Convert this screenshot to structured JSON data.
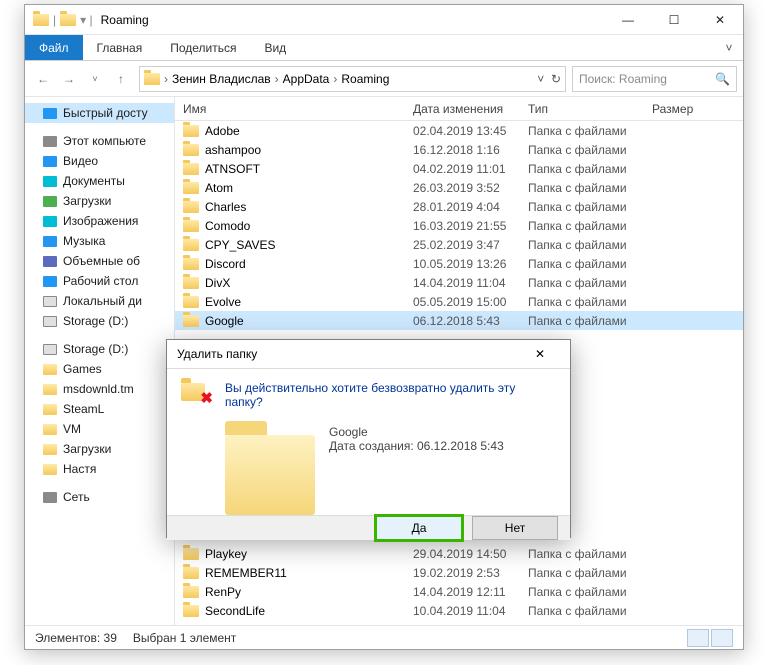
{
  "window": {
    "title": "Roaming"
  },
  "ribbon": {
    "file": "Файл",
    "home": "Главная",
    "share": "Поделиться",
    "view": "Вид"
  },
  "breadcrumb": {
    "parts": [
      "Зенин Владислав",
      "AppData",
      "Roaming"
    ]
  },
  "search": {
    "placeholder": "Поиск: Roaming"
  },
  "columns": {
    "name": "Имя",
    "date": "Дата изменения",
    "type": "Тип",
    "size": "Размер"
  },
  "nav": {
    "quick": "Быстрый досту",
    "thispc": "Этот компьюте",
    "video": "Видео",
    "docs": "Документы",
    "downloads": "Загрузки",
    "images": "Изображения",
    "music": "Музыка",
    "volume": "Объемные об",
    "desktop": "Рабочий стол",
    "localdisk": "Локальный ди",
    "storage1": "Storage (D:)",
    "storage2": "Storage (D:)",
    "games": "Games",
    "msdownld": "msdownld.tm",
    "steaml": "SteamL",
    "vm": "VM",
    "downloads2": "Загрузки",
    "nastya": "Настя",
    "network": "Сеть"
  },
  "type_folder": "Папка с файлами",
  "rows": [
    {
      "name": "Adobe",
      "date": "02.04.2019 13:45"
    },
    {
      "name": "ashampoo",
      "date": "16.12.2018 1:16"
    },
    {
      "name": "ATNSOFT",
      "date": "04.02.2019 11:01"
    },
    {
      "name": "Atom",
      "date": "26.03.2019 3:52"
    },
    {
      "name": "Charles",
      "date": "28.01.2019 4:04"
    },
    {
      "name": "Comodo",
      "date": "16.03.2019 21:55"
    },
    {
      "name": "CPY_SAVES",
      "date": "25.02.2019 3:47"
    },
    {
      "name": "Discord",
      "date": "10.05.2019 13:26"
    },
    {
      "name": "DivX",
      "date": "14.04.2019 11:04"
    },
    {
      "name": "Evolve",
      "date": "05.05.2019 15:00"
    },
    {
      "name": "Google",
      "date": "06.12.2018 5:43",
      "sel": true
    },
    {
      "name": "Playkey",
      "date": "29.04.2019 14:50"
    },
    {
      "name": "REMEMBER11",
      "date": "19.02.2019 2:53"
    },
    {
      "name": "RenPy",
      "date": "14.04.2019 12:11"
    },
    {
      "name": "SecondLife",
      "date": "10.04.2019 11:04"
    }
  ],
  "status": {
    "count": "Элементов: 39",
    "sel": "Выбран 1 элемент"
  },
  "dialog": {
    "title": "Удалить папку",
    "message": "Вы действительно хотите безвозвратно удалить эту папку?",
    "item_name": "Google",
    "item_date": "Дата создания: 06.12.2018 5:43",
    "yes": "Да",
    "no": "Нет"
  }
}
